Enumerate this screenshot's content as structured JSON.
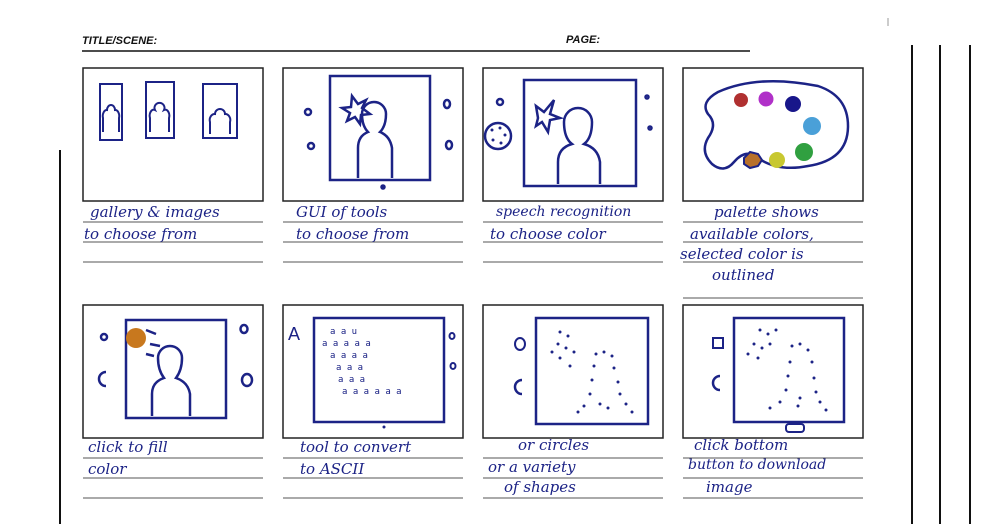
{
  "header": {
    "title_label": "TITLE/SCENE:",
    "page_label": "PAGE:"
  },
  "colors": {
    "ink": "#1c2386",
    "frame": "#222222",
    "rule": "#555555",
    "palette_red": "#b03030",
    "palette_purple": "#b030c8",
    "palette_navy": "#18168a",
    "palette_blue": "#4aa0d8",
    "palette_green": "#30a040",
    "palette_yellow": "#c8c830",
    "palette_orange": "#b8702a"
  },
  "panels": [
    {
      "icons": [
        "portrait-frame-icon",
        "portrait-frame-icon",
        "portrait-frame-icon"
      ],
      "caption_lines": [
        "gallery & images",
        "to choose from"
      ]
    },
    {
      "icons": [
        "portrait-icon",
        "star-icon",
        "tool-circle-icon"
      ],
      "caption_lines": [
        "GUI of tools",
        "to choose from"
      ]
    },
    {
      "icons": [
        "portrait-icon",
        "star-icon",
        "palette-icon"
      ],
      "caption_lines": [
        "speech recognition",
        "to choose color"
      ]
    },
    {
      "icons": [
        "palette-icon"
      ],
      "caption_lines": [
        "palette shows",
        "available colors,",
        "selected color is",
        "outlined"
      ]
    },
    {
      "icons": [
        "portrait-icon",
        "filled-star-icon",
        "paint-bucket-icon"
      ],
      "caption_lines": [
        "click to fill",
        "color"
      ]
    },
    {
      "icons": [
        "ascii-portrait-icon",
        "letter-a-icon"
      ],
      "caption_lines": [
        "tool to convert",
        "to ASCII"
      ]
    },
    {
      "icons": [
        "dotted-portrait-icon",
        "tool-circle-icon"
      ],
      "caption_lines": [
        "or circles",
        "or a variety",
        "of shapes"
      ]
    },
    {
      "icons": [
        "dotted-portrait-icon",
        "download-button-icon"
      ],
      "caption_lines": [
        "click bottom",
        "button to download",
        "image"
      ]
    }
  ]
}
